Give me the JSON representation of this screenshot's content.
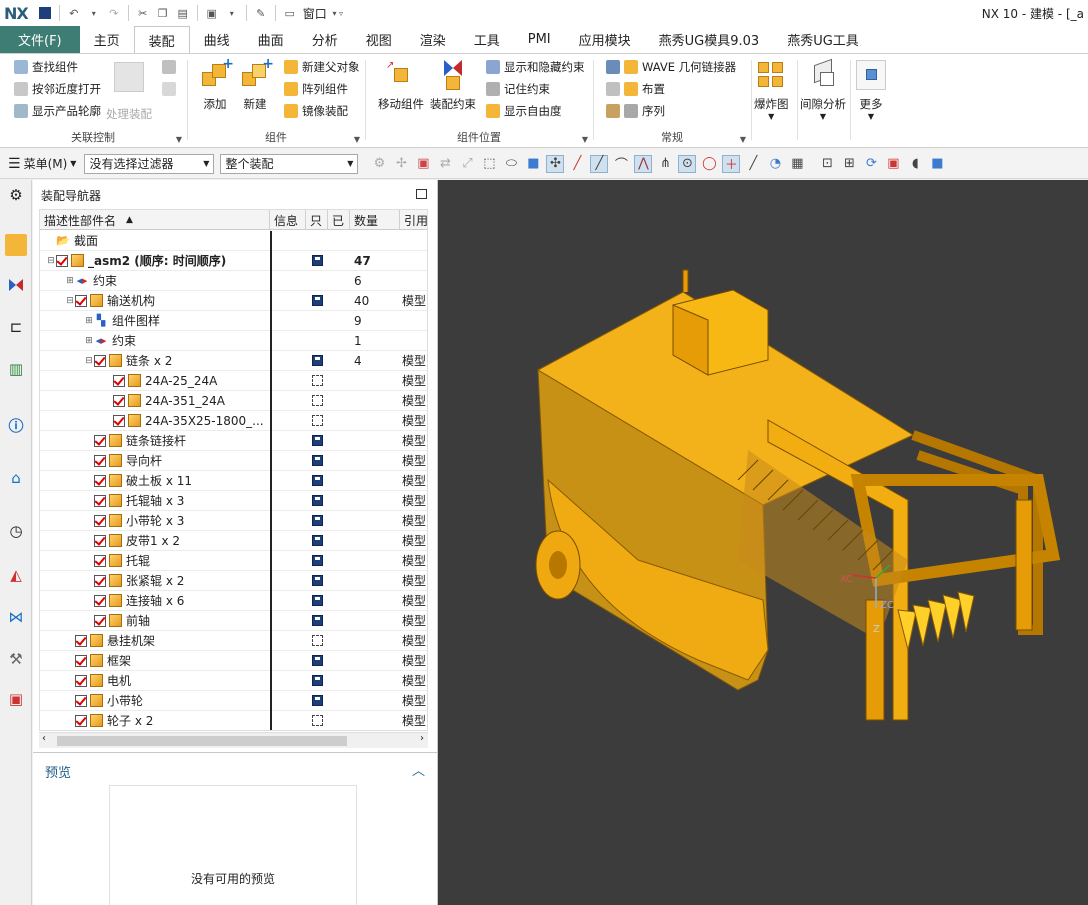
{
  "app": {
    "logo": "NX",
    "window_menu": "窗口",
    "title": "NX 10 - 建模 - [_a"
  },
  "tabs": [
    "文件(F)",
    "主页",
    "装配",
    "曲线",
    "曲面",
    "分析",
    "视图",
    "渲染",
    "工具",
    "PMI",
    "应用模块",
    "燕秀UG模具9.03",
    "燕秀UG工具"
  ],
  "active_tab": "装配",
  "ribbon": {
    "assoc": {
      "find": "查找组件",
      "open_near": "按邻近度打开",
      "show_outline": "显示产品轮廓",
      "sub": "处理装配",
      "label": "关联控制"
    },
    "component": {
      "add": "添加",
      "new": "新建",
      "new_parent": "新建父对象",
      "array": "阵列组件",
      "mirror": "镜像装配",
      "label": "组件"
    },
    "position": {
      "move": "移动组件",
      "constraint": "装配约束",
      "show_hide": "显示和隐藏约束",
      "remember": "记住约束",
      "dof": "显示自由度",
      "label": "组件位置"
    },
    "general": {
      "wave": "WAVE 几何链接器",
      "layout": "布置",
      "sequence": "序列",
      "label": "常规"
    },
    "explode": "爆炸图",
    "clearance": "间隙分析",
    "more": "更多"
  },
  "toolbar": {
    "menu": "菜单(M)",
    "filter": "没有选择过滤器",
    "scope": "整个装配"
  },
  "navigator": {
    "title": "装配导航器",
    "columns": [
      "描述性部件名",
      "信息",
      "只",
      "已",
      "数量",
      "引用"
    ],
    "rows": [
      {
        "name": "截面",
        "level": 0,
        "qty": "",
        "ref": ""
      },
      {
        "name": "_asm2 (顺序: 时间顺序)",
        "level": 0,
        "qty": "47",
        "ref": ""
      },
      {
        "name": "约束",
        "level": 1,
        "qty": "6",
        "ref": ""
      },
      {
        "name": "输送机构",
        "level": 1,
        "qty": "40",
        "ref": "模型"
      },
      {
        "name": "组件图样",
        "level": 2,
        "qty": "9",
        "ref": ""
      },
      {
        "name": "约束",
        "level": 2,
        "qty": "1",
        "ref": ""
      },
      {
        "name": "链条 x 2",
        "level": 2,
        "qty": "4",
        "ref": "模型"
      },
      {
        "name": "24A-25_24A",
        "level": 3,
        "qty": "",
        "ref": "模型"
      },
      {
        "name": "24A-351_24A",
        "level": 3,
        "qty": "",
        "ref": "模型"
      },
      {
        "name": "24A-35X25-1800_...",
        "level": 3,
        "qty": "",
        "ref": "模型"
      },
      {
        "name": "链条链接杆",
        "level": 2,
        "qty": "",
        "ref": "模型"
      },
      {
        "name": "导向杆",
        "level": 2,
        "qty": "",
        "ref": "模型"
      },
      {
        "name": "破土板 x 11",
        "level": 2,
        "qty": "",
        "ref": "模型"
      },
      {
        "name": "托辊轴 x 3",
        "level": 2,
        "qty": "",
        "ref": "模型"
      },
      {
        "name": "小带轮 x 3",
        "level": 2,
        "qty": "",
        "ref": "模型"
      },
      {
        "name": "皮带1 x 2",
        "level": 2,
        "qty": "",
        "ref": "模型"
      },
      {
        "name": "托辊",
        "level": 2,
        "qty": "",
        "ref": "模型"
      },
      {
        "name": "张紧辊 x 2",
        "level": 2,
        "qty": "",
        "ref": "模型"
      },
      {
        "name": "连接轴 x 6",
        "level": 2,
        "qty": "",
        "ref": "模型"
      },
      {
        "name": "前轴",
        "level": 2,
        "qty": "",
        "ref": "模型"
      },
      {
        "name": "悬挂机架",
        "level": 1,
        "qty": "",
        "ref": "模型"
      },
      {
        "name": "框架",
        "level": 1,
        "qty": "",
        "ref": "模型"
      },
      {
        "name": "电机",
        "level": 1,
        "qty": "",
        "ref": "模型"
      },
      {
        "name": "小带轮",
        "level": 1,
        "qty": "",
        "ref": "模型"
      },
      {
        "name": "轮子 x 2",
        "level": 1,
        "qty": "",
        "ref": "模型"
      }
    ]
  },
  "preview": {
    "title": "预览",
    "message": "没有可用的预览"
  },
  "axes": {
    "xc": "XC",
    "yc": "YC",
    "zc": "ZC",
    "z": "Z"
  }
}
